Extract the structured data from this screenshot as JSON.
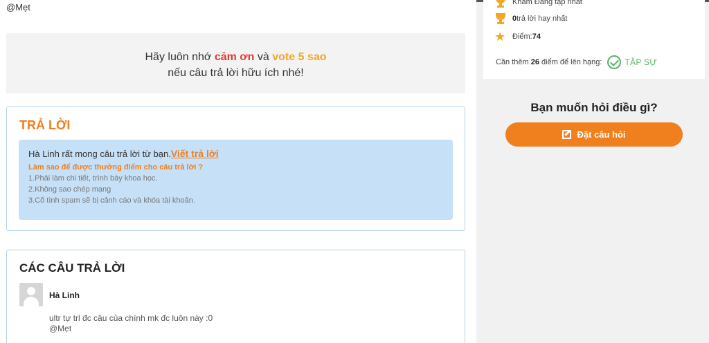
{
  "mention_top": "@Mẹt",
  "reminder": {
    "line1_prefix": "Hãy luôn nhớ ",
    "thanks": "cảm ơn",
    "line1_middle": " và ",
    "vote": "vote 5 sao",
    "line2": "nếu câu trả lời hữu ích nhé!"
  },
  "answer_section": {
    "title": "TRẢ LỜI",
    "invite": "Hà Linh rất mong câu trả lời từ bạn.",
    "write_link": "Viết trả lời",
    "how_title": "Làm sao để được thưởng điểm cho câu trả lời ?",
    "rules": [
      "1.Phải làm chi tiết, trình bày khoa học.",
      "2.Không sao chép mạng",
      "3.Cố tình spam sẽ bị cảnh cáo và khóa tài khoản."
    ]
  },
  "answers_section": {
    "title": "CÁC CÂU TRẢ LỜI",
    "items": [
      {
        "author": "Hà Linh",
        "text": "ultr tự trl đc câu của chính mk đc luôn này :0",
        "mention": "@Mẹt"
      }
    ]
  },
  "sidebar": {
    "clipped_label": "Khám Đáng tập nhất",
    "best_count": "0",
    "best_label": " trả lời hay nhất",
    "points_label": "Điểm: ",
    "points_value": "74",
    "needs_prefix": "Cần thêm",
    "needs_value": "26",
    "needs_suffix": "điểm để lên hạng:",
    "rank": "TẬP SỰ",
    "ask_heading": "Bạn muốn hỏi điều gì?",
    "ask_button": "Đặt câu hỏi"
  },
  "colors": {
    "accent": "#f07f1e",
    "thanks": "#e53935",
    "vote": "#f5a623",
    "rank": "#58b368",
    "info_bg": "#c6e0f7"
  }
}
